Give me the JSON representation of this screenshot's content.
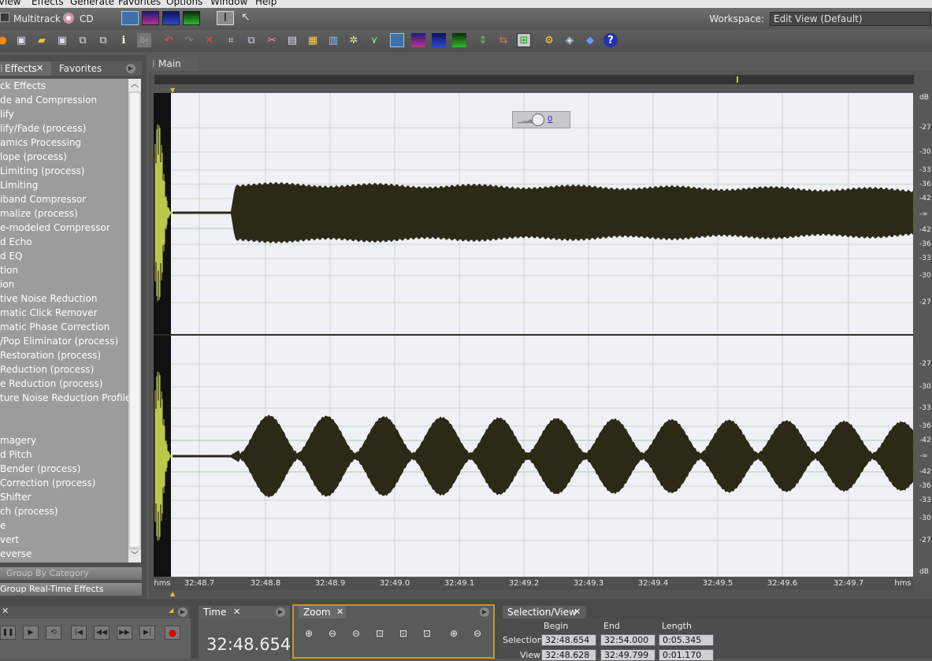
{
  "menu": [
    "View",
    "Effects",
    "Generate",
    "Favorites",
    "Options",
    "Window",
    "Help"
  ],
  "toolbar1": {
    "multitrack_label": "Multitrack",
    "cd_label": "CD"
  },
  "workspace": {
    "label": "Workspace:",
    "value": "Edit View (Default)"
  },
  "left_panel": {
    "tabs": [
      "Effects",
      "Favorites"
    ],
    "items": [
      "ck Effects",
      "de and Compression",
      "lify",
      "lify/Fade (process)",
      "amics Processing",
      "lope (process)",
      "Limiting (process)",
      "Limiting",
      "iband Compressor",
      "malize (process)",
      "e-modeled Compressor",
      "d Echo",
      "d EQ",
      "tion",
      "ion",
      "tive Noise Reduction",
      "matic Click Remover",
      "matic Phase Correction",
      "/Pop Eliminator (process)",
      "Restoration (process)",
      "Reduction (process)",
      "e Reduction (process)",
      "ture Noise Reduction Profile",
      "",
      "",
      "magery",
      "d Pitch",
      "Bender (process)",
      "Correction (process)",
      "Shifter",
      "ch (process)",
      "e",
      "vert",
      "everse"
    ],
    "group_by_category": "Group By Category",
    "group_realtime": "Group Real-Time Effects"
  },
  "main": {
    "tab": "Main",
    "overlay_value": "0",
    "time_labels": [
      "hms",
      "32:48.7",
      "32:48.8",
      "32:48.9",
      "32:49.0",
      "32:49.1",
      "32:49.2",
      "32:49.3",
      "32:49.4",
      "32:49.5",
      "32:49.6",
      "32:49.7",
      "hms"
    ],
    "db_labels_top": [
      "dB",
      "-27",
      "-30",
      "-33",
      "-36",
      "-42",
      "-∞",
      "-42",
      "-36",
      "-33",
      "-30",
      "-27"
    ],
    "db_labels_bottom": [
      "-27",
      "-30",
      "-33",
      "-36",
      "-42",
      "-∞",
      "-42",
      "-36",
      "-33",
      "-30",
      "-27",
      "dB"
    ]
  },
  "bottom": {
    "time_tab": "Time",
    "time_value": "32:48.654",
    "zoom_tab": "Zoom",
    "selview_tab": "Selection/View",
    "headers": [
      "Begin",
      "End",
      "Length"
    ],
    "selection": {
      "label": "Selection",
      "begin": "32:48.654",
      "end": "32:54.000",
      "length": "0:05.345"
    },
    "view": {
      "label": "View",
      "begin": "32:48.628",
      "end": "32:49.799",
      "length": "0:01.170"
    }
  },
  "colors": {
    "waveform": "#2b2a17",
    "background": "#f0f0f7",
    "accent": "#c99a18",
    "transient": "#bcc84c"
  }
}
